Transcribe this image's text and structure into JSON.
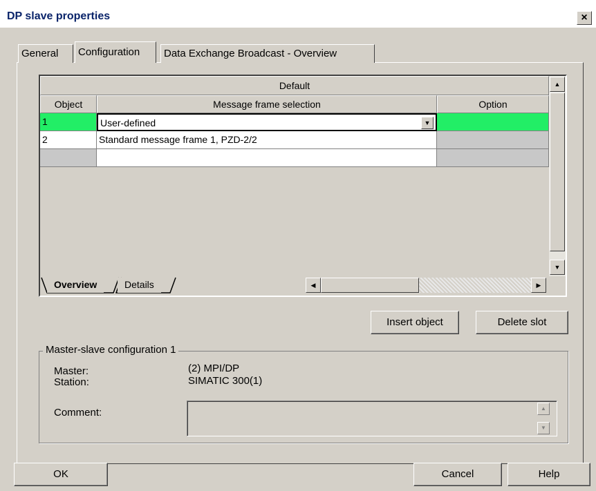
{
  "window": {
    "title": "DP slave properties",
    "close_glyph": "×"
  },
  "tabs": [
    {
      "label": "General"
    },
    {
      "label": "Configuration"
    },
    {
      "label": "Data Exchange Broadcast - Overview"
    }
  ],
  "grid": {
    "group_header": "Default",
    "columns": [
      "Object",
      "Message frame selection",
      "Option"
    ],
    "rows": [
      {
        "object": "1",
        "selection": "User-defined",
        "option": ""
      },
      {
        "object": "2",
        "selection": "Standard message frame 1, PZD-2/2",
        "option": ""
      },
      {
        "object": "",
        "selection": "",
        "option": ""
      }
    ],
    "bottom_tabs": [
      "Overview",
      "Details"
    ]
  },
  "buttons": {
    "insert_object": "Insert object",
    "delete_slot": "Delete slot",
    "ok": "OK",
    "cancel": "Cancel",
    "help": "Help"
  },
  "group": {
    "title": "Master-slave configuration 1",
    "master_label": "Master:",
    "master_value": "(2) MPI/DP",
    "station_label": "Station:",
    "station_value": "SIMATIC 300(1)",
    "comment_label": "Comment:",
    "comment_value": ""
  },
  "colors": {
    "selected_row": "#22ee66",
    "dialog": "#d4d0c8",
    "title_text": "#0a246a"
  },
  "icons": [
    "close-icon",
    "dropdown-arrow-icon",
    "scroll-up-icon",
    "scroll-down-icon",
    "scroll-left-icon",
    "scroll-right-icon"
  ]
}
